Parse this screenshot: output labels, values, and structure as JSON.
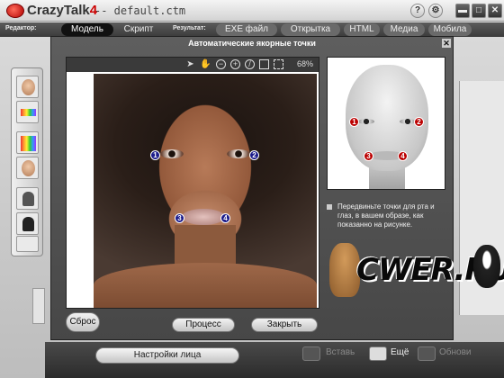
{
  "app": {
    "logo_main": "CrazyTalk",
    "logo_num": "4",
    "document": "-- default.ctm"
  },
  "window_buttons": [
    "?",
    "⚙",
    "▬",
    "□",
    "✕"
  ],
  "menubar": {
    "editor_label": "Редактор:",
    "editor_tabs": [
      "Модель",
      "Скрипт"
    ],
    "result_label": "Результат:",
    "result_tabs": [
      "EXE файл",
      "Открытка",
      "HTML",
      "Медиа",
      "Мобила"
    ]
  },
  "dialog": {
    "title": "Автоматические якорные точки",
    "close": "✕",
    "zoom": "68%",
    "hint": "Передвиньте точки для рта и глаз, в вашем образе, как показанно на рисунке.",
    "buttons": {
      "reset": "Сброс",
      "process": "Процесс",
      "close": "Закрыть"
    },
    "markers": [
      "1",
      "2",
      "3",
      "4"
    ],
    "ref_markers": [
      "1",
      "2",
      "3",
      "4"
    ]
  },
  "bottom": {
    "face_settings": "Настройки лица",
    "insert": "Вставь",
    "more": "Ещё",
    "update": "Обнови"
  },
  "watermark": {
    "text": "CWER.RU"
  },
  "icons": {
    "viewer_tools": [
      "pointer-icon",
      "hand-icon",
      "zoom-out-icon",
      "zoom-in-icon",
      "no-icon",
      "fit-icon",
      "actual-size-icon"
    ]
  }
}
